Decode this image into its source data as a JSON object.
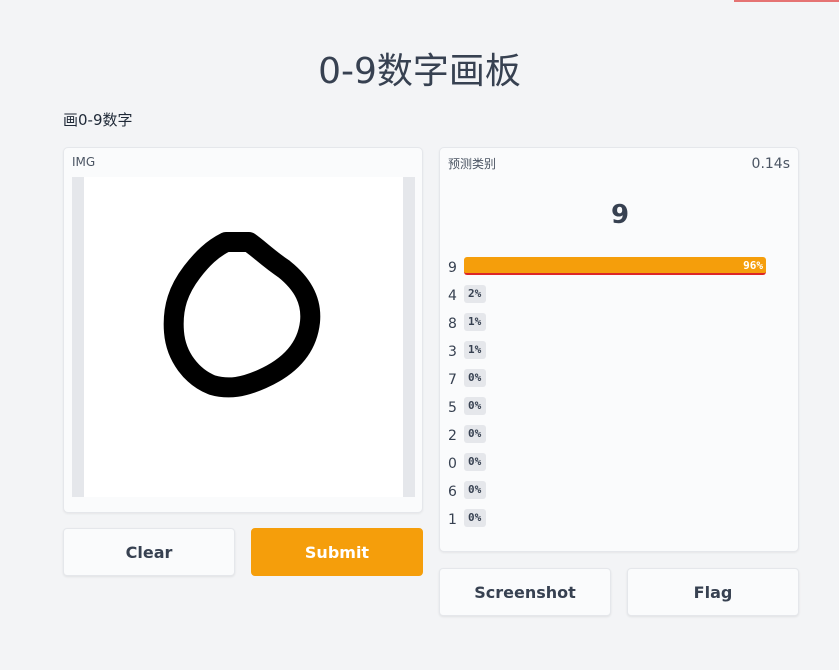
{
  "page": {
    "title": "0-9数字画板",
    "subtitle": "画0-9数字"
  },
  "input_panel": {
    "label": "IMG"
  },
  "output_panel": {
    "label": "预测类别",
    "timing": "0.14s",
    "predicted": "9",
    "predictions": [
      {
        "label": "9",
        "percent_text": "96%",
        "value": 0.96
      },
      {
        "label": "4",
        "percent_text": "2%",
        "value": 0.02
      },
      {
        "label": "8",
        "percent_text": "1%",
        "value": 0.01
      },
      {
        "label": "3",
        "percent_text": "1%",
        "value": 0.01
      },
      {
        "label": "7",
        "percent_text": "0%",
        "value": 0.0
      },
      {
        "label": "5",
        "percent_text": "0%",
        "value": 0.0
      },
      {
        "label": "2",
        "percent_text": "0%",
        "value": 0.0
      },
      {
        "label": "0",
        "percent_text": "0%",
        "value": 0.0
      },
      {
        "label": "6",
        "percent_text": "0%",
        "value": 0.0
      },
      {
        "label": "1",
        "percent_text": "0%",
        "value": 0.0
      }
    ]
  },
  "buttons": {
    "clear": "Clear",
    "submit": "Submit",
    "screenshot": "Screenshot",
    "flag": "Flag"
  },
  "colors": {
    "accent": "#f59e0b",
    "background": "#f3f4f6",
    "panel": "#fafbfc"
  }
}
